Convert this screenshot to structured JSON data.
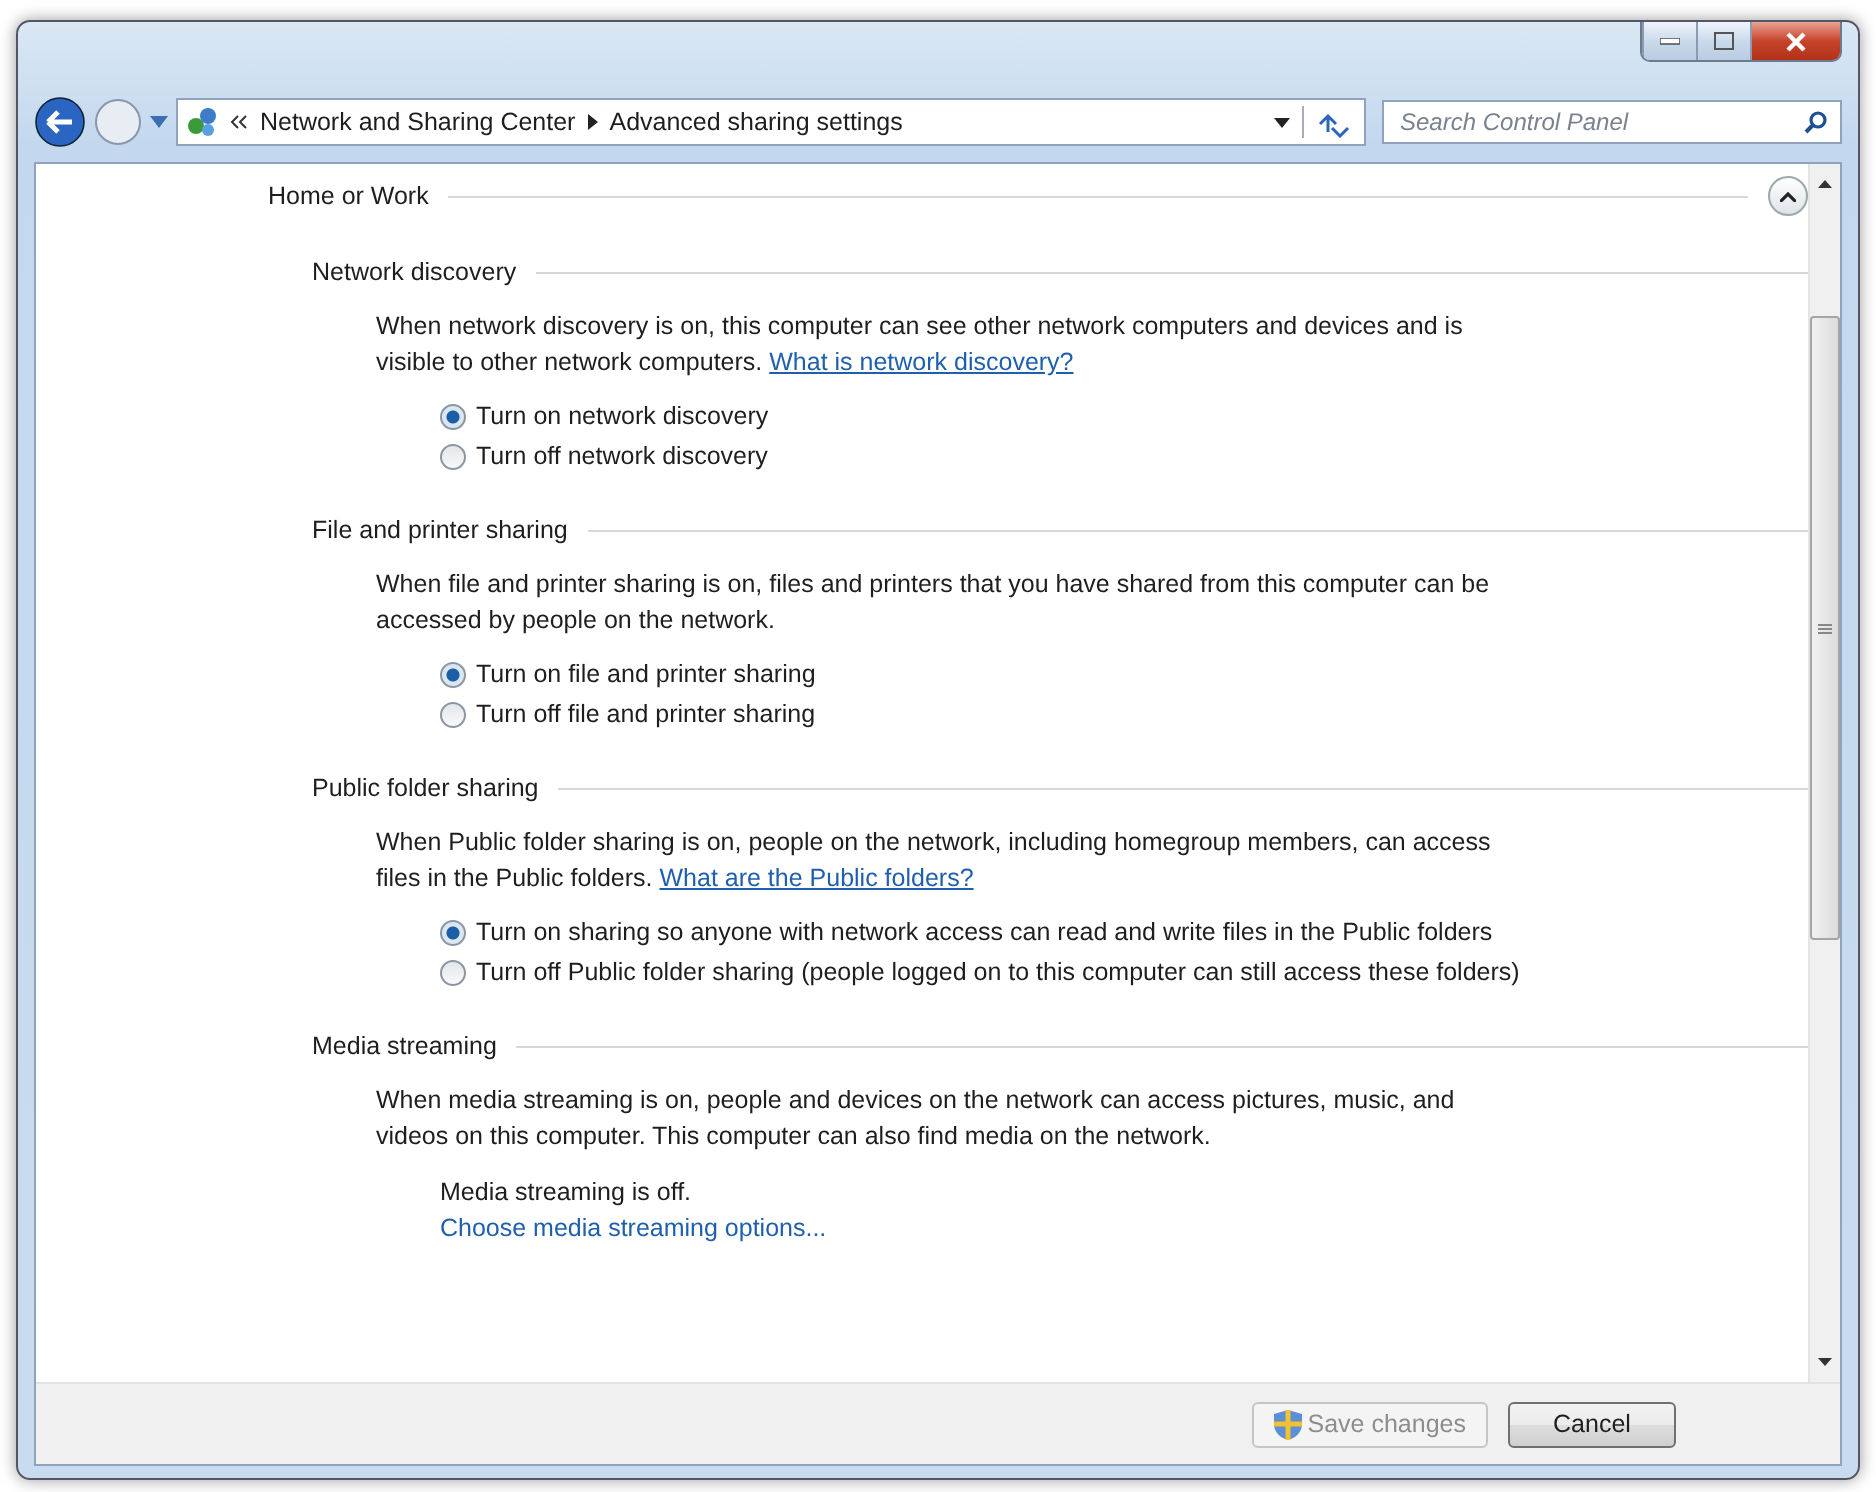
{
  "address_bar": {
    "crumbs": [
      "Network and Sharing Center",
      "Advanced sharing settings"
    ]
  },
  "search": {
    "placeholder": "Search Control Panel"
  },
  "group": {
    "title": "Home or Work",
    "expanded": true
  },
  "sections": [
    {
      "kind": "radio",
      "title": "Network discovery",
      "description": "When network discovery is on, this computer can see other network computers and devices and is visible to other network computers.",
      "link": "What is network discovery?",
      "options": [
        {
          "label": "Turn on network discovery",
          "selected": true
        },
        {
          "label": "Turn off network discovery",
          "selected": false
        }
      ]
    },
    {
      "kind": "radio",
      "title": "File and printer sharing",
      "description": "When file and printer sharing is on, files and printers that you have shared from this computer can be accessed by people on the network.",
      "options": [
        {
          "label": "Turn on file and printer sharing",
          "selected": true
        },
        {
          "label": "Turn off file and printer sharing",
          "selected": false
        }
      ]
    },
    {
      "kind": "radio",
      "title": "Public folder sharing",
      "description": "When Public folder sharing is on, people on the network, including homegroup members, can access files in the Public folders.",
      "link": "What are the Public folders?",
      "options": [
        {
          "label": "Turn on sharing so anyone with network access can read and write files in the Public folders",
          "selected": true
        },
        {
          "label": "Turn off Public folder sharing (people logged on to this computer can still access these folders)",
          "selected": false
        }
      ]
    },
    {
      "kind": "status",
      "title": "Media streaming",
      "description": "When media streaming is on, people and devices on the network can access pictures, music, and videos on this computer. This computer can also find media on the network.",
      "status": "Media streaming is off.",
      "action": "Choose media streaming options..."
    }
  ],
  "buttons": [
    {
      "label": "Save changes",
      "disabled": true,
      "shield": true
    },
    {
      "label": "Cancel",
      "disabled": false,
      "shield": false
    }
  ]
}
